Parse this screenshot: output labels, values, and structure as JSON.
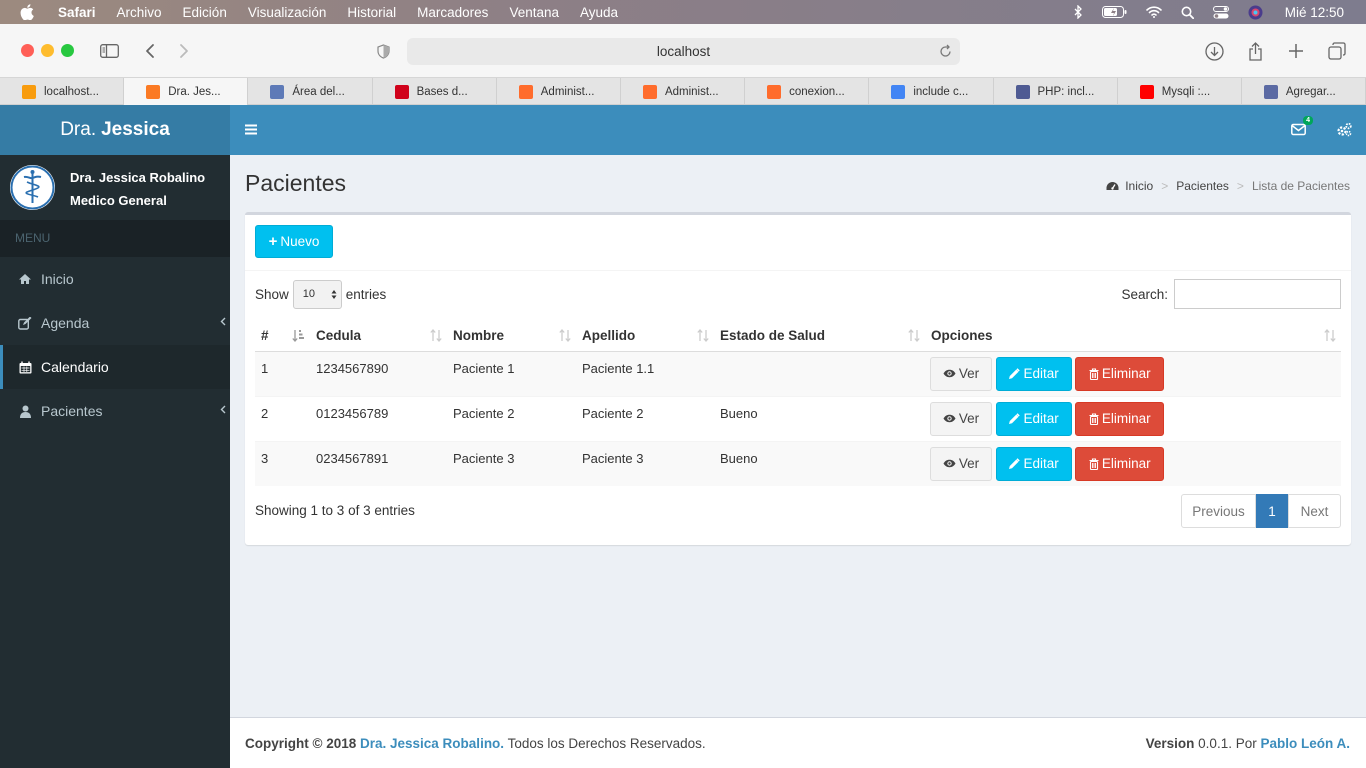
{
  "os_menubar": {
    "app": "Safari",
    "items": [
      "Archivo",
      "Edición",
      "Visualización",
      "Historial",
      "Marcadores",
      "Ventana",
      "Ayuda"
    ],
    "clock": "Mié 12:50"
  },
  "browser": {
    "url": "localhost",
    "tabs": [
      {
        "label": "localhost...",
        "icon": "phpmyadmin-icon",
        "color": "#f89c0e"
      },
      {
        "label": "Dra. Jes...",
        "icon": "xampp-icon",
        "color": "#fb7a24"
      },
      {
        "label": "Área del...",
        "icon": "hub-icon",
        "color": "#5e7ab7"
      },
      {
        "label": "Bases d...",
        "icon": "dots-icon",
        "color": "#d0021b"
      },
      {
        "label": "Administ...",
        "icon": "cpanel-icon",
        "color": "#ff6c2c"
      },
      {
        "label": "Administ...",
        "icon": "cpanel-icon",
        "color": "#ff6c2c"
      },
      {
        "label": "conexion...",
        "icon": "cpanel-icon",
        "color": "#ff6c2c"
      },
      {
        "label": "include c...",
        "icon": "google-icon",
        "color": "#4285f4"
      },
      {
        "label": "PHP: incl...",
        "icon": "php-icon",
        "color": "#4f5b93"
      },
      {
        "label": "Mysqli :...",
        "icon": "youtube-icon",
        "color": "#ff0000"
      },
      {
        "label": "Agregar...",
        "icon": "bracket-icon",
        "color": "#5b6aa3"
      }
    ]
  },
  "app": {
    "logo_light": "Dra.",
    "logo_bold": "Jessica",
    "mail_count": "4"
  },
  "sidebar": {
    "user_name": "Dra. Jessica Robalino",
    "user_role": "Medico General",
    "menu_header": "MENU",
    "items": [
      {
        "label": "Inicio",
        "icon": "home-icon"
      },
      {
        "label": "Agenda",
        "icon": "edit-icon"
      },
      {
        "label": "Calendario",
        "icon": "calendar-icon"
      },
      {
        "label": "Pacientes",
        "icon": "user-icon"
      }
    ]
  },
  "page": {
    "title": "Pacientes",
    "breadcrumb": [
      "Inicio",
      "Pacientes",
      "Lista de Pacientes"
    ]
  },
  "table_controls": {
    "new_button": "Nuevo",
    "show_label": "Show",
    "entries_value": "10",
    "entries_label": "entries",
    "search_label": "Search:",
    "search_value": ""
  },
  "table": {
    "columns": [
      "#",
      "Cedula",
      "Nombre",
      "Apellido",
      "Estado de Salud",
      "Opciones"
    ],
    "rows": [
      {
        "num": "1",
        "cedula": "1234567890",
        "nombre": "Paciente 1",
        "apellido": "Paciente 1.1",
        "estado": ""
      },
      {
        "num": "2",
        "cedula": "0123456789",
        "nombre": "Paciente 2",
        "apellido": "Paciente 2",
        "estado": "Bueno"
      },
      {
        "num": "3",
        "cedula": "0234567891",
        "nombre": "Paciente 3",
        "apellido": "Paciente 3",
        "estado": "Bueno"
      }
    ],
    "actions": {
      "view": "Ver",
      "edit": "Editar",
      "delete": "Eliminar"
    }
  },
  "pagination": {
    "info": "Showing 1 to 3 of 3 entries",
    "previous": "Previous",
    "page": "1",
    "next": "Next"
  },
  "footer": {
    "copyright": "Copyright © 2018",
    "owner": "Dra. Jessica Robalino.",
    "rights": "Todos los Derechos Reservados.",
    "version_label": "Version",
    "version": "0.0.1. Por",
    "author": "Pablo León A."
  },
  "colors": {
    "primary": "#3c8dbc",
    "sidebar": "#222d32",
    "info": "#00c0ef",
    "danger": "#dd4b39"
  }
}
